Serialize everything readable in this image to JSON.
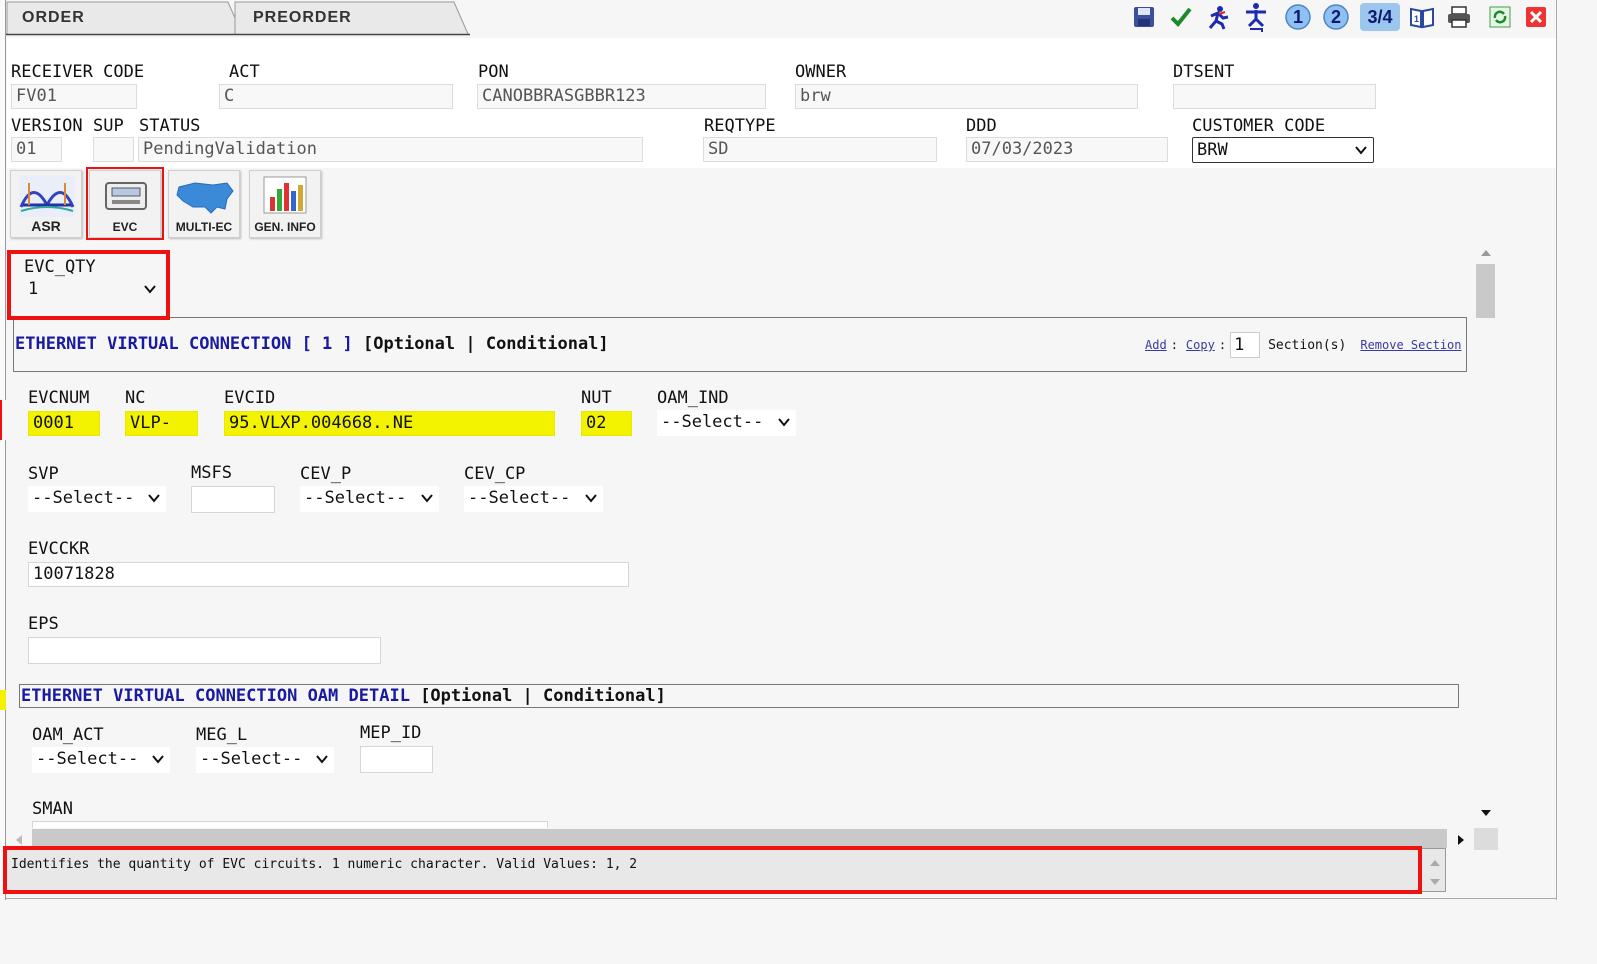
{
  "tabs": [
    {
      "label": "ORDER"
    },
    {
      "label": "PREORDER"
    }
  ],
  "toolbar": {
    "icons": [
      "save-icon",
      "check-icon",
      "run-icon",
      "run-alt-icon",
      "page-1-icon",
      "page-2-icon",
      "page-3-4-icon",
      "book-icon",
      "print-icon",
      "refresh-icon",
      "close-icon"
    ],
    "page1": "1",
    "page2": "2",
    "page34": "3/4"
  },
  "header": {
    "receiver_code": {
      "label": "RECEIVER CODE",
      "value": "FV01"
    },
    "act": {
      "label": "ACT",
      "value": "C"
    },
    "pon": {
      "label": "PON",
      "value": "CANOBBRASGBBR123"
    },
    "owner": {
      "label": "OWNER",
      "value": "brw"
    },
    "dtsent": {
      "label": "DTSENT",
      "value": ""
    },
    "version": {
      "label": "VERSION",
      "value": "01"
    },
    "sup": {
      "label": "SUP",
      "value": ""
    },
    "status": {
      "label": "STATUS",
      "value": "PendingValidation"
    },
    "reqtype": {
      "label": "REQTYPE",
      "value": "SD"
    },
    "ddd": {
      "label": "DDD",
      "value": "07/03/2023"
    },
    "customer_code": {
      "label": "CUSTOMER CODE",
      "value": "BRW"
    }
  },
  "form_tabs": [
    {
      "label": "ASR"
    },
    {
      "label": "EVC"
    },
    {
      "label": "MULTI-EC"
    },
    {
      "label": "GEN. INFO"
    }
  ],
  "evc_qty": {
    "label": "EVC_QTY",
    "value": "1"
  },
  "section1": {
    "title_blue": "ETHERNET VIRTUAL CONNECTION [ 1 ]",
    "title_rest": "[Optional | Conditional]",
    "add": "Add",
    "copy": "Copy",
    "colon": ":",
    "copy_count": "1",
    "sections_label": "Section(s)",
    "remove": "Remove Section"
  },
  "fields": {
    "evcnum": {
      "label": "EVCNUM",
      "value": "0001"
    },
    "nc": {
      "label": "NC",
      "value": "VLP-"
    },
    "evcid": {
      "label": "EVCID",
      "value": "95.VLXP.004668..NE"
    },
    "nut": {
      "label": "NUT",
      "value": "02"
    },
    "oam_ind": {
      "label": "OAM_IND",
      "value": "--Select--"
    },
    "svp": {
      "label": "SVP",
      "value": "--Select--"
    },
    "msfs": {
      "label": "MSFS",
      "value": ""
    },
    "cev_p": {
      "label": "CEV_P",
      "value": "--Select--"
    },
    "cev_cp": {
      "label": "CEV_CP",
      "value": "--Select--"
    },
    "evcckr": {
      "label": "EVCCKR",
      "value": "10071828"
    },
    "eps": {
      "label": "EPS",
      "value": ""
    }
  },
  "section2": {
    "title_blue": "ETHERNET VIRTUAL CONNECTION OAM DETAIL",
    "title_rest": "[Optional | Conditional]"
  },
  "oam": {
    "oam_act": {
      "label": "OAM_ACT",
      "value": "--Select--"
    },
    "meg_l": {
      "label": "MEG_L",
      "value": "--Select--"
    },
    "mep_id": {
      "label": "MEP_ID",
      "value": ""
    },
    "sman": {
      "label": "SMAN",
      "value": ""
    }
  },
  "help_text": "Identifies the quantity of EVC circuits. 1 numeric character. Valid Values: 1, 2",
  "colors": {
    "highlight_red": "#e11111",
    "field_yellow": "#f3f300",
    "section_blue": "#1a1aa0"
  }
}
